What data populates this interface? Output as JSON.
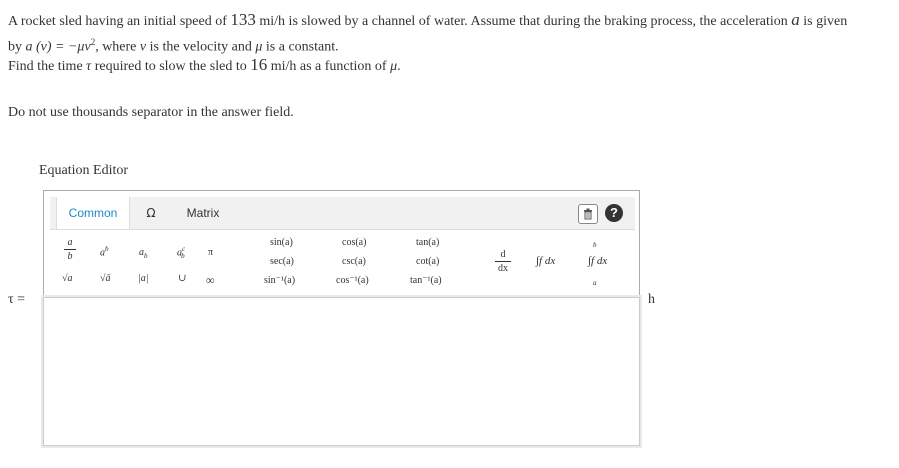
{
  "question": {
    "line1_a": "A rocket sled having an initial speed of ",
    "line1_speed": "133",
    "line1_b": " mi/h is slowed by a channel of water. Assume that during the braking process, the acceleration ",
    "line1_var": "a",
    "line1_c": " is given",
    "line2_a": "by ",
    "line2_eq": "a (v) = −μv",
    "line2_sup": "2",
    "line2_b": ", where ",
    "line2_v": "v",
    "line2_c": " is the velocity and ",
    "line2_mu": "μ",
    "line2_d": " is a constant.",
    "line3_a": "Find the time ",
    "line3_tau": "τ",
    "line3_b": " required to slow the sled to ",
    "line3_speed": "16",
    "line3_c": " mi/h as a function of ",
    "line3_mu": "μ",
    "line3_d": ".",
    "note": "Do not use thousands separator in the answer field."
  },
  "editor": {
    "title": "Equation Editor",
    "tabs": [
      "Common",
      "Ω",
      "Matrix"
    ],
    "active_tab": "Common",
    "accent_color": "#1a8cc5",
    "trash_icon": "trash-icon",
    "help_icon": "question-icon",
    "help_glyph": "?",
    "symbols": {
      "power": "a",
      "power_sup": "b",
      "subscript": "a",
      "subscript_sub": "b",
      "subsup": "a",
      "subsup_sup": "c",
      "subsup_sub": "b",
      "pi": "π",
      "sqrt": "√a",
      "nthroot": "√ā",
      "abs": "|a|",
      "union": "∪",
      "infinity": "∞",
      "frac_num": "a",
      "frac_den": "b",
      "deriv_num": "d",
      "deriv_den": "dx",
      "integral": "∫f dx",
      "definite_integral": "∫f dx",
      "int_upper": "b",
      "int_lower": "a"
    },
    "trig": [
      [
        "sin(a)",
        "cos(a)",
        "tan(a)"
      ],
      [
        "sec(a)",
        "csc(a)",
        "cot(a)"
      ],
      [
        "sin⁻¹(a)",
        "cos⁻¹(a)",
        "tan⁻¹(a)"
      ]
    ]
  },
  "answer": {
    "label": "τ =",
    "value": "",
    "unit": "h"
  }
}
